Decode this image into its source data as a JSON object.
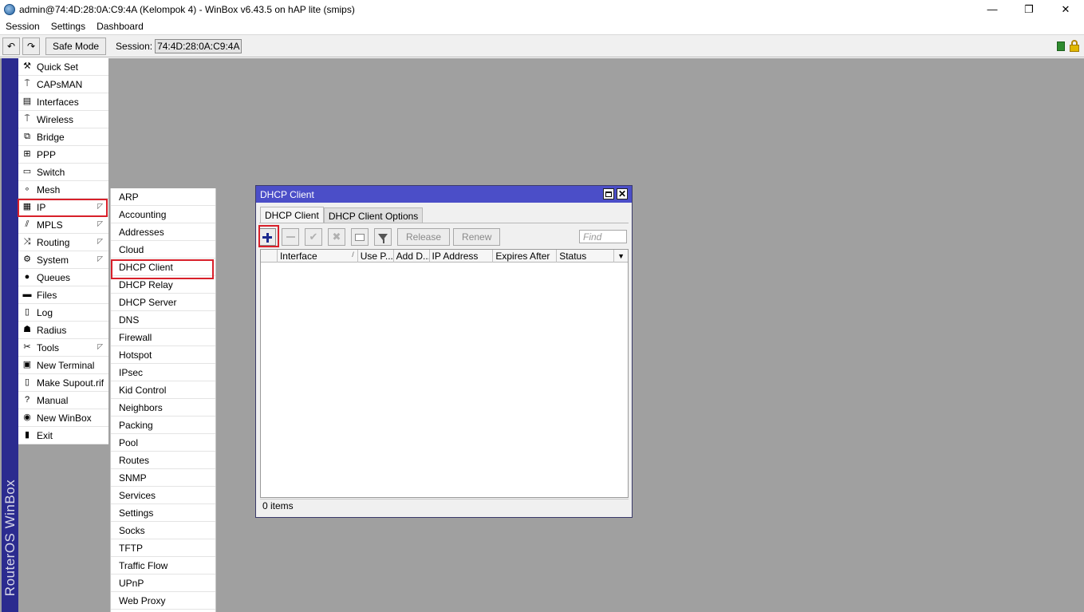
{
  "window": {
    "title": "admin@74:4D:28:0A:C9:4A (Kelompok 4) - WinBox v6.43.5 on hAP lite (smips)",
    "controls": {
      "minimize": "—",
      "restore": "❐",
      "close": "✕"
    }
  },
  "menubar": {
    "items": [
      "Session",
      "Settings",
      "Dashboard"
    ]
  },
  "toolbar": {
    "undo_icon": "↶",
    "redo_icon": "↷",
    "safe_mode_label": "Safe Mode",
    "session_label": "Session:",
    "session_value": "74:4D:28:0A:C9:4A"
  },
  "brand": {
    "text": "RouterOS WinBox"
  },
  "main_menu": {
    "items": [
      {
        "label": "Quick Set",
        "icon": "⚒",
        "submenu": false
      },
      {
        "label": "CAPsMAN",
        "icon": "⍑",
        "submenu": false
      },
      {
        "label": "Interfaces",
        "icon": "▤",
        "submenu": false
      },
      {
        "label": "Wireless",
        "icon": "⍑",
        "submenu": false
      },
      {
        "label": "Bridge",
        "icon": "⧉",
        "submenu": false
      },
      {
        "label": "PPP",
        "icon": "⊞",
        "submenu": false
      },
      {
        "label": "Switch",
        "icon": "▭",
        "submenu": false
      },
      {
        "label": "Mesh",
        "icon": "∘",
        "submenu": false
      },
      {
        "label": "IP",
        "icon": "▦",
        "submenu": true
      },
      {
        "label": "MPLS",
        "icon": "⫽",
        "submenu": true
      },
      {
        "label": "Routing",
        "icon": "⤨",
        "submenu": true
      },
      {
        "label": "System",
        "icon": "⚙",
        "submenu": true
      },
      {
        "label": "Queues",
        "icon": "●",
        "submenu": false
      },
      {
        "label": "Files",
        "icon": "▬",
        "submenu": false
      },
      {
        "label": "Log",
        "icon": "▯",
        "submenu": false
      },
      {
        "label": "Radius",
        "icon": "☗",
        "submenu": false
      },
      {
        "label": "Tools",
        "icon": "✂",
        "submenu": true
      },
      {
        "label": "New Terminal",
        "icon": "▣",
        "submenu": false
      },
      {
        "label": "Make Supout.rif",
        "icon": "▯",
        "submenu": false
      },
      {
        "label": "Manual",
        "icon": "?",
        "submenu": false
      },
      {
        "label": "New WinBox",
        "icon": "◉",
        "submenu": false
      },
      {
        "label": "Exit",
        "icon": "▮",
        "submenu": false
      }
    ],
    "submenu_arrow": "◸"
  },
  "ip_submenu": {
    "items": [
      "ARP",
      "Accounting",
      "Addresses",
      "Cloud",
      "DHCP Client",
      "DHCP Relay",
      "DHCP Server",
      "DNS",
      "Firewall",
      "Hotspot",
      "IPsec",
      "Kid Control",
      "Neighbors",
      "Packing",
      "Pool",
      "Routes",
      "SNMP",
      "Services",
      "Settings",
      "Socks",
      "TFTP",
      "Traffic Flow",
      "UPnP",
      "Web Proxy"
    ]
  },
  "dhcp_window": {
    "title": "DHCP Client",
    "close_glyph": "✕",
    "tabs": [
      "DHCP Client",
      "DHCP Client Options"
    ],
    "toolbar": {
      "check_glyph": "✔",
      "x_glyph": "✖",
      "release_label": "Release",
      "renew_label": "Renew",
      "find_placeholder": "Find"
    },
    "columns": [
      "Interface",
      "Use P...",
      "Add D...",
      "IP Address",
      "Expires After",
      "Status"
    ],
    "sort_indicator": "/",
    "dropdown_glyph": "▼",
    "status_text": "0 items"
  },
  "colors": {
    "accent_blue": "#4b4ec8",
    "brand_strip": "#2b2b8f",
    "highlight_red": "#d8202a",
    "workspace_gray": "#a0a0a0"
  }
}
